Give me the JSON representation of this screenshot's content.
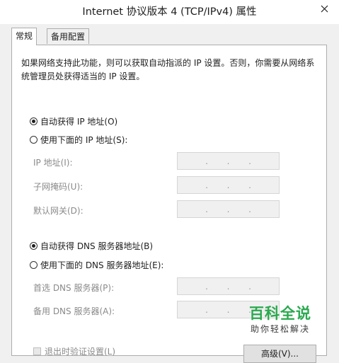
{
  "window": {
    "title": "Internet 协议版本 4 (TCP/IPv4) 属性",
    "close_icon": "close-icon"
  },
  "tabs": [
    {
      "label": "常规",
      "active": true
    },
    {
      "label": "备用配置",
      "active": false
    }
  ],
  "description": "如果网络支持此功能，则可以获取自动指派的 IP 设置。否则，你需要从网络系统管理员处获得适当的 IP 设置。",
  "ip_section": {
    "auto_label": "自动获得 IP 地址(O)",
    "auto_checked": true,
    "manual_label": "使用下面的 IP 地址(S):",
    "manual_checked": false,
    "fields": [
      {
        "label": "IP 地址(I):",
        "value": ".       .       ."
      },
      {
        "label": "子网掩码(U):",
        "value": ".       .       ."
      },
      {
        "label": "默认网关(D):",
        "value": ".       .       ."
      }
    ]
  },
  "dns_section": {
    "auto_label": "自动获得 DNS 服务器地址(B)",
    "auto_checked": true,
    "manual_label": "使用下面的 DNS 服务器地址(E):",
    "manual_checked": false,
    "fields": [
      {
        "label": "首选 DNS 服务器(P):",
        "value": ".       .       ."
      },
      {
        "label": "备用 DNS 服务器(A):",
        "value": ".       .       ."
      }
    ]
  },
  "validate_label": "退出时验证设置(L)",
  "advanced_button": "高级(V)...",
  "watermark": {
    "title": "百科全说",
    "subtitle": "助你轻松解决"
  }
}
